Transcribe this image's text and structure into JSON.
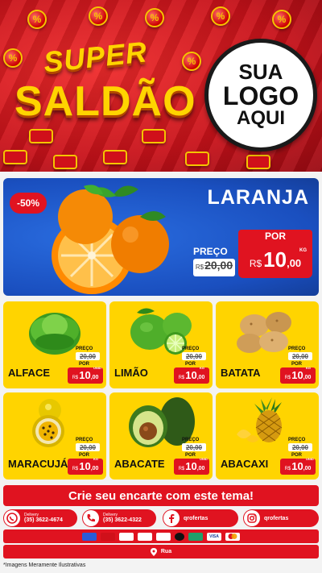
{
  "header": {
    "brand_top": "SUPER",
    "brand_bottom": "SALDÃO",
    "coin_symbol": "%",
    "logo": {
      "line1": "SUA",
      "line2": "LOGO",
      "line3": "AQUI"
    }
  },
  "featured": {
    "discount": "-50%",
    "name": "LARANJA",
    "preco_label": "PREÇO",
    "old_currency": "R$",
    "old_price": "20,00",
    "por_label": "POR",
    "currency": "R$",
    "price_int": "10",
    "price_dec": ",00",
    "unit": "KG"
  },
  "products": [
    {
      "name": "ALFACE",
      "preco_label": "PREÇO",
      "old_price": "20,00",
      "por_label": "POR",
      "currency": "R$",
      "price_int": "10",
      "price_dec": ",00",
      "unit": "UNID",
      "art": "lettuce"
    },
    {
      "name": "LIMÃO",
      "preco_label": "PREÇO",
      "old_price": "20,00",
      "por_label": "POR",
      "currency": "R$",
      "price_int": "10",
      "price_dec": ",00",
      "unit": "KG",
      "art": "lime"
    },
    {
      "name": "BATATA",
      "preco_label": "PREÇO",
      "old_price": "20,00",
      "por_label": "POR",
      "currency": "R$",
      "price_int": "10",
      "price_dec": ",00",
      "unit": "KG",
      "art": "potato"
    },
    {
      "name": "MARACUJÁ",
      "preco_label": "PREÇO",
      "old_price": "20,00",
      "por_label": "POR",
      "currency": "R$",
      "price_int": "10",
      "price_dec": ",00",
      "unit": "KG",
      "art": "passionfruit"
    },
    {
      "name": "ABACATE",
      "preco_label": "PREÇO",
      "old_price": "20,00",
      "por_label": "POR",
      "currency": "R$",
      "price_int": "10",
      "price_dec": ",00",
      "unit": "UNID",
      "art": "avocado"
    },
    {
      "name": "ABACAXI",
      "preco_label": "PREÇO",
      "old_price": "20,00",
      "por_label": "POR",
      "currency": "R$",
      "price_int": "10",
      "price_dec": ",00",
      "unit": "UNID",
      "art": "pineapple"
    }
  ],
  "cta": {
    "label": "Crie seu encarte com este tema!"
  },
  "contacts": [
    {
      "icon": "whatsapp-icon",
      "small": "Delivery",
      "main": "(35) 3622-4674"
    },
    {
      "icon": "phone-icon",
      "small": "Delivery",
      "main": "(35) 3622-4322"
    },
    {
      "icon": "facebook-icon",
      "small": "",
      "main": "qrofertas"
    },
    {
      "icon": "instagram-icon",
      "small": "",
      "main": "qrofertas"
    }
  ],
  "payments": [
    "",
    "",
    "",
    "",
    "",
    "",
    "",
    "VISA",
    ""
  ],
  "address": {
    "label": "Rua"
  },
  "footer_note": "*Imagens Meramente Ilustrativas",
  "colors": {
    "red": "#e01320",
    "yellow": "#ffd400",
    "blue": "#1a4fbf"
  }
}
